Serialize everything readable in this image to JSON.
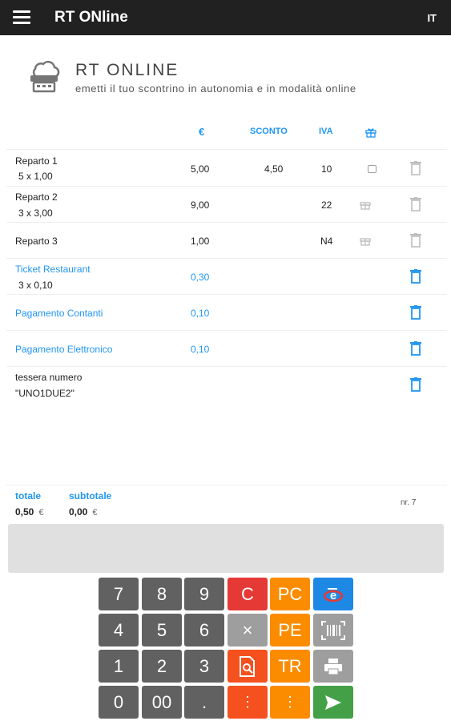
{
  "appbar": {
    "title": "RT ONline",
    "language": "IT"
  },
  "header": {
    "title": "RT ONLINE",
    "subtitle": "emetti il tuo scontrino in autonomia e in modalità online"
  },
  "columns": {
    "price": "€",
    "discount": "SCONTO",
    "vat": "IVA"
  },
  "rows": [
    {
      "name": "Reparto 1",
      "qty": "5 x 1,00",
      "amount": "5,00",
      "discount": "4,50",
      "vat": "10"
    },
    {
      "name": "Reparto 2",
      "qty": "3 x 3,00",
      "amount": "9,00",
      "discount": "",
      "vat": "22"
    },
    {
      "name": "Reparto 3",
      "qty": "",
      "amount": "1,00",
      "discount": "",
      "vat": "N4"
    },
    {
      "name": "Ticket Restaurant",
      "qty": "3 x 0,10",
      "amount": "0,30"
    },
    {
      "name": "Pagamento Contanti",
      "amount": "0,10"
    },
    {
      "name": "Pagamento Elettronico",
      "amount": "0,10"
    },
    {
      "name": "tessera numero",
      "qty": "\"UNO1DUE2\""
    }
  ],
  "totals": {
    "total_label": "totale",
    "total_value": "0,50",
    "subtotal_label": "subtotale",
    "subtotal_value": "0,00",
    "currency": "€",
    "count": "nr. 7"
  },
  "keypad": {
    "digits": [
      "7",
      "8",
      "9",
      "4",
      "5",
      "6",
      "1",
      "2",
      "3",
      "0",
      "00",
      "."
    ],
    "clear": "C",
    "multiply": "×",
    "pc": "PC",
    "pe": "PE",
    "tr": "TR",
    "more": "⋮"
  },
  "colors": {
    "accent": "#2196f3",
    "appbar": "#212121",
    "red": "#e53935",
    "orange": "#fb8c00",
    "green": "#43a047",
    "blue": "#1e88e5"
  }
}
